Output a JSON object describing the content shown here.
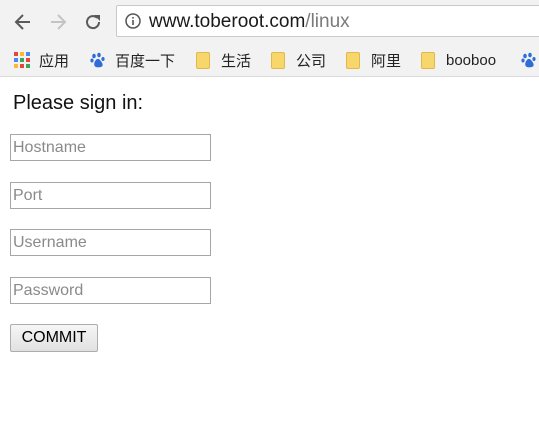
{
  "browser": {
    "url_host": "www.toberoot.com",
    "url_path": "/linux",
    "icons": {
      "back": "back-arrow-icon",
      "forward": "forward-arrow-icon",
      "reload": "reload-icon",
      "info": "info-icon"
    }
  },
  "bookmarks": {
    "items": [
      {
        "label": "应用",
        "icon": "apps-grid-icon"
      },
      {
        "label": "百度一下",
        "icon": "baidu-paw-icon"
      },
      {
        "label": "生活",
        "icon": "folder-icon"
      },
      {
        "label": "公司",
        "icon": "folder-icon"
      },
      {
        "label": "阿里",
        "icon": "folder-icon"
      },
      {
        "label": "booboo",
        "icon": "folder-icon"
      }
    ]
  },
  "form": {
    "heading": "Please sign in:",
    "fields": [
      {
        "placeholder": "Hostname",
        "value": ""
      },
      {
        "placeholder": "Port",
        "value": ""
      },
      {
        "placeholder": "Username",
        "value": ""
      },
      {
        "placeholder": "Password",
        "value": ""
      }
    ],
    "submit_label": "COMMIT"
  },
  "colors": {
    "toolbar_bg": "#f2f2f2",
    "folder": "#f7d66c",
    "baidu_blue": "#2f6cd8"
  }
}
